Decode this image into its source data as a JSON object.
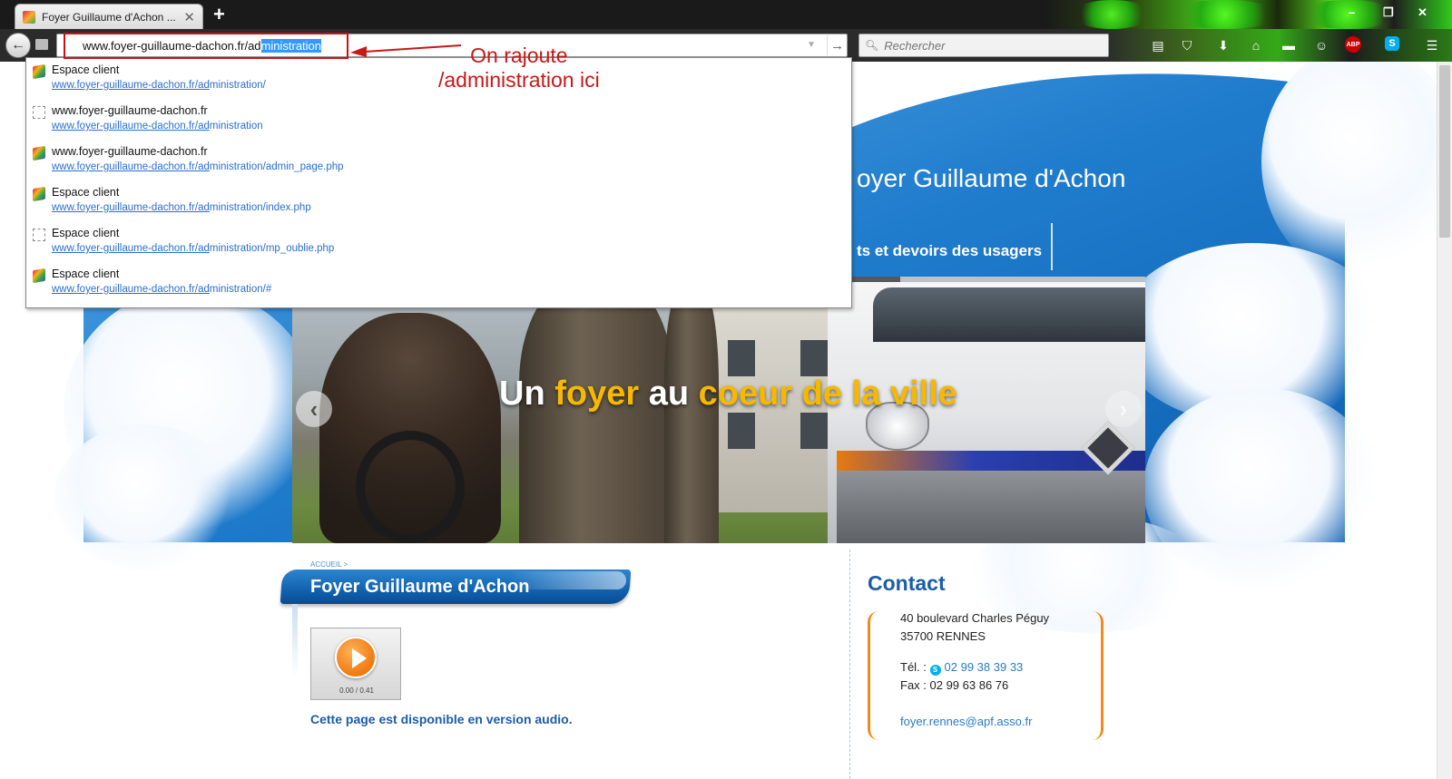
{
  "browser": {
    "tab_title": "Foyer Guillaume d'Achon ...",
    "new_tab": "+",
    "url_prefix": "www.foyer-guillaume-dachon.fr/ad",
    "url_selected": "ministration",
    "search_placeholder": "Rechercher",
    "window_controls": [
      "–",
      "❐",
      "✕"
    ]
  },
  "annotation": {
    "line1": "On rajoute",
    "line2": "/administration ici"
  },
  "autocomplete": [
    {
      "icon": "cube-icon",
      "title": "Espace client",
      "url_match": "www.foyer-guillaume-dachon.fr/ad",
      "url_rest": "ministration/"
    },
    {
      "icon": "blank-page-icon",
      "title": "www.foyer-guillaume-dachon.fr",
      "url_match": "www.foyer-guillaume-dachon.fr/ad",
      "url_rest": "ministration"
    },
    {
      "icon": "cube-icon",
      "title": "www.foyer-guillaume-dachon.fr",
      "url_match": "www.foyer-guillaume-dachon.fr/ad",
      "url_rest": "ministration/admin_page.php"
    },
    {
      "icon": "cube-icon",
      "title": "Espace client",
      "url_match": "www.foyer-guillaume-dachon.fr/ad",
      "url_rest": "ministration/index.php"
    },
    {
      "icon": "blank-page-icon",
      "title": "Espace client",
      "url_match": "www.foyer-guillaume-dachon.fr/ad",
      "url_rest": "ministration/mp_oublie.php"
    },
    {
      "icon": "cube-icon",
      "title": "Espace client",
      "url_match": "www.foyer-guillaume-dachon.fr/ad",
      "url_rest": "ministration/#"
    }
  ],
  "site": {
    "header_title": "oyer Guillaume d'Achon",
    "nav_item": "ts et devoirs des usagers",
    "slogan": {
      "w1": "Un",
      "w2": "foyer",
      "w3": "au",
      "w4": "coeur",
      "w5": "de",
      "w6": "la",
      "w7": "ville"
    },
    "breadcrumb": "ACCUEIL >",
    "page_title": "Foyer Guillaume d'Achon",
    "audio_time": "0.00 / 0.41",
    "audio_note": "Cette page est disponible en version audio.",
    "contact": {
      "title": "Contact",
      "address1": "40 boulevard Charles Péguy",
      "address2": "35700 RENNES",
      "tel_label": "Tél. :",
      "tel": "02 99 38 39 33",
      "fax": "Fax : 02 99 63 86 76",
      "email": "foyer.rennes@apf.asso.fr"
    }
  },
  "colors": {
    "accent_blue": "#1c5ca8",
    "annotation_red": "#c81818",
    "slogan_yellow": "#f6b800",
    "contact_orange": "#f28a1a"
  }
}
